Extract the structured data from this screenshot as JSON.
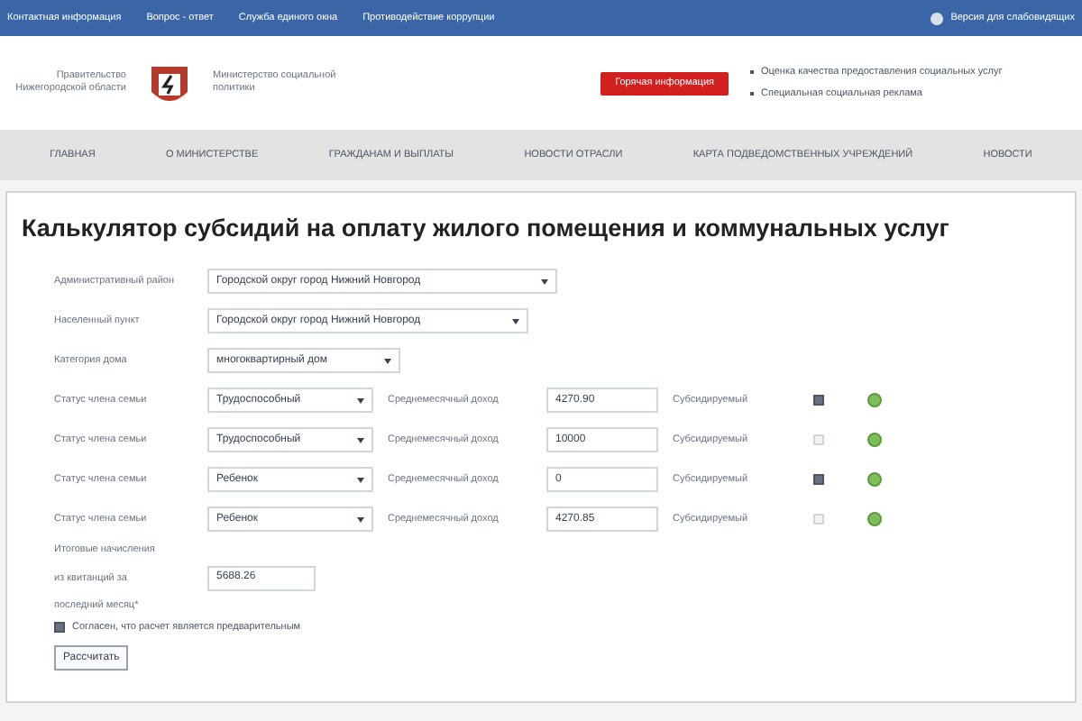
{
  "top_bar": {
    "links": [
      "Контактная информация",
      "Вопрос - ответ",
      "Служба единого окна",
      "Противодействие коррупции"
    ],
    "right_link": "Версия для слабовидящих"
  },
  "header": {
    "left_text": "Правительство Нижегородской области",
    "right_text": "Министерство социальной политики",
    "alert_button": "Горячая информация",
    "links": [
      "Оценка качества предоставления социальных услуг",
      "Специальная социальная реклама"
    ]
  },
  "nav": [
    "ГЛАВНАЯ",
    "О МИНИСТЕРСТВЕ",
    "ГРАЖДАНАМ И ВЫПЛАТЫ",
    "НОВОСТИ ОТРАСЛИ",
    "КАРТА ПОДВЕДОМСТВЕННЫХ УЧРЕЖДЕНИЙ",
    "НОВОСТИ"
  ],
  "title": "Калькулятор субсидий на оплату жилого помещения и коммунальных услуг",
  "fields": [
    {
      "label": "Административный район",
      "value": "Городской округ город Нижний Новгород"
    },
    {
      "label": "Населенный пункт",
      "value": "Городской округ город Нижний Новгород"
    },
    {
      "label": "Категория дома",
      "value": "многоквартирный дом"
    }
  ],
  "members": [
    {
      "label": "Статус члена семьи",
      "status": "Трудоспособный",
      "income_label": "Среднемесячный доход",
      "income": "4270.90",
      "subsidized_label": "Субсидируемый",
      "checked": true
    },
    {
      "label": "Статус члена семьи",
      "status": "Трудоспособный",
      "income_label": "Среднемесячный доход",
      "income": "10000",
      "subsidized_label": "Субсидируемый",
      "checked": false
    },
    {
      "label": "Статус члена семьи",
      "status": "Ребенок",
      "income_label": "Среднемесячный доход",
      "income": "0",
      "subsidized_label": "Субсидируемый",
      "checked": true
    },
    {
      "label": "Статус члена семьи",
      "status": "Ребенок",
      "income_label": "Среднемесячный доход",
      "income": "4270.85",
      "subsidized_label": "Субсидируемый",
      "checked": false
    }
  ],
  "charges": {
    "label_lines": [
      "Итоговые начисления",
      "из квитанций за",
      "последний месяц*"
    ],
    "value": "5688.26"
  },
  "agree": {
    "label": "Согласен, что расчет является предварительным",
    "checked": true
  },
  "submit": "Рассчитать"
}
